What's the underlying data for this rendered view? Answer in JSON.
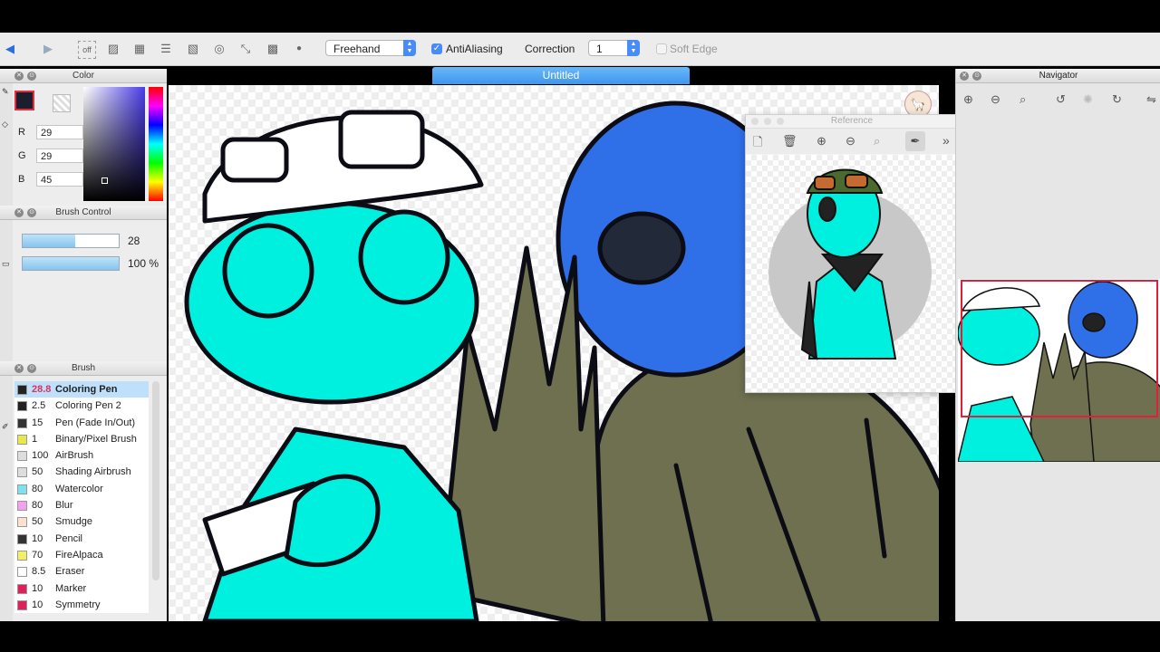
{
  "toolbar": {
    "mode_value": "Freehand",
    "antialiasing_label": "AntiAliasing",
    "antialiasing_checked": true,
    "correction_label": "Correction",
    "correction_value": "1",
    "soft_edge_label": "Soft Edge"
  },
  "document": {
    "title": "Untitled"
  },
  "color_panel": {
    "title": "Color",
    "r_label": "R",
    "r_value": "29",
    "g_label": "G",
    "g_value": "29",
    "b_label": "B",
    "b_value": "45",
    "current_color": "#1d1d2d"
  },
  "brush_control": {
    "title": "Brush Control",
    "size_value": "28",
    "opacity_value": "100 %"
  },
  "brush_panel": {
    "title": "Brush",
    "items": [
      {
        "size": "28.8",
        "name": "Coloring Pen",
        "color": "#222222",
        "selected": true
      },
      {
        "size": "2.5",
        "name": "Coloring Pen 2",
        "color": "#222222"
      },
      {
        "size": "15",
        "name": "Pen (Fade In/Out)",
        "color": "#333333"
      },
      {
        "size": "1",
        "name": "Binary/Pixel Brush",
        "color": "#e8e84a"
      },
      {
        "size": "100",
        "name": "AirBrush",
        "color": "#dddddd"
      },
      {
        "size": "50",
        "name": "Shading Airbrush",
        "color": "#dddddd"
      },
      {
        "size": "80",
        "name": "Watercolor",
        "color": "#7fe0f0"
      },
      {
        "size": "80",
        "name": "Blur",
        "color": "#f4a0f0"
      },
      {
        "size": "50",
        "name": "Smudge",
        "color": "#fde0d0"
      },
      {
        "size": "10",
        "name": "Pencil",
        "color": "#333333"
      },
      {
        "size": "70",
        "name": "FireAlpaca",
        "color": "#f0f060"
      },
      {
        "size": "8.5",
        "name": "Eraser",
        "color": "#ffffff"
      },
      {
        "size": "10",
        "name": "Marker",
        "color": "#e0205a"
      },
      {
        "size": "10",
        "name": "Symmetry",
        "color": "#e0205a"
      }
    ]
  },
  "reference_panel": {
    "title": "Reference"
  },
  "navigator_panel": {
    "title": "Navigator"
  },
  "colors": {
    "accent": "#4a8cf7",
    "cyan": "#00f0e0",
    "blue": "#2f6fe8",
    "olive": "#6e7050"
  }
}
